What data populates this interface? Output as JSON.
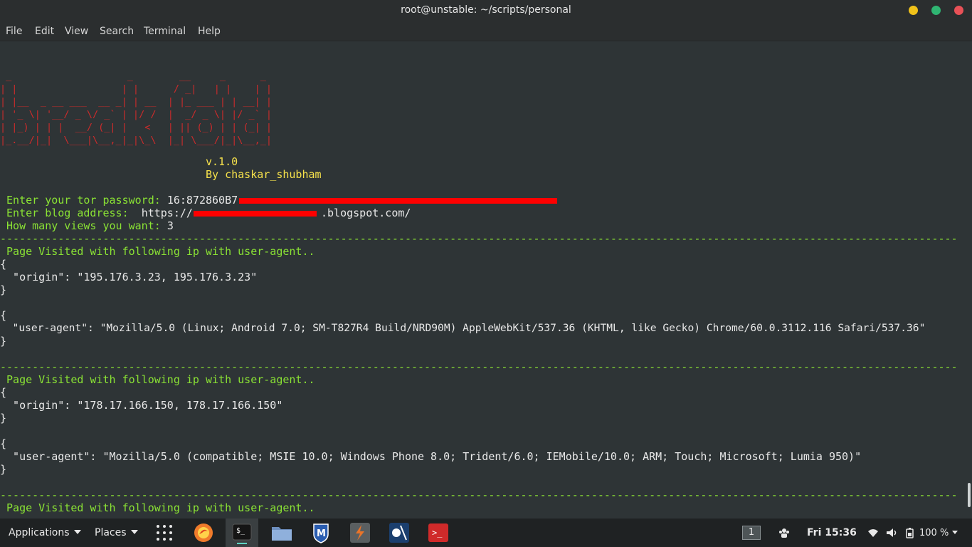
{
  "window": {
    "title": "root@unstable: ~/scripts/personal",
    "controls": {
      "minimize_color": "#f0c21a",
      "maximize_color": "#2fb572",
      "close_color": "#e85157"
    }
  },
  "menubar": {
    "items": [
      "File",
      "Edit",
      "View",
      "Search",
      "Terminal",
      "Help"
    ]
  },
  "terminal": {
    "banner_ascii": [
      " _                    _        __     _      _ ",
      "| |                  | |      / _|   | |    | |",
      "| |__  _ __ ___  __ _| | __  | |_ ___ | | __| |",
      "| '_ \\| '__/ _ \\/ _` | |/ /  |  _/ _ \\| |/ _` |",
      "| |_) | | |  __/ (_| |   <   | || (_) | | (_| |",
      "|_.__/|_|  \\___|\\__,_|_|\\_\\  |_| \\___/|_|\\__,_|"
    ],
    "version": "v.1.0",
    "author": "By chaskar_shubham",
    "prompts": {
      "tor_label": " Enter your tor password: ",
      "tor_value": "16:872860B7",
      "blog_label": " Enter blog address:  ",
      "blog_prefix": "https://",
      "blog_suffix": ".blogspot.com/",
      "views_label": " How many views you want: ",
      "views_value": "3"
    },
    "separator": "-----------------------------------------------------------------------------------------------------------------------------------------------------",
    "visits": [
      {
        "header": " Page Visited with following ip with user-agent..",
        "open1": "{",
        "origin_line": "  \"origin\": \"195.176.3.23, 195.176.3.23\"",
        "close1": "}",
        "open2": "{",
        "ua_line": "  \"user-agent\": \"Mozilla/5.0 (Linux; Android 7.0; SM-T827R4 Build/NRD90M) AppleWebKit/537.36 (KHTML, like Gecko) Chrome/60.0.3112.116 Safari/537.36\"",
        "close2": "}"
      },
      {
        "header": " Page Visited with following ip with user-agent..",
        "open1": "{",
        "origin_line": "  \"origin\": \"178.17.166.150, 178.17.166.150\"",
        "close1": "}",
        "open2": "{",
        "ua_line": "  \"user-agent\": \"Mozilla/5.0 (compatible; MSIE 10.0; Windows Phone 8.0; Trident/6.0; IEMobile/10.0; ARM; Touch; Microsoft; Lumia 950)\"",
        "close2": "}"
      },
      {
        "header": " Page Visited with following ip with user-agent.."
      }
    ],
    "colors": {
      "background": "#2e3436",
      "banner": "#cc2b2b",
      "version": "#f7e24b",
      "prompt": "#8ae234",
      "redaction": "#ff0000"
    }
  },
  "taskbar": {
    "applications_label": "Applications",
    "places_label": "Places",
    "launchers": [
      {
        "icon": "firefox-icon",
        "color": "#f07b2b"
      },
      {
        "icon": "terminal-icon",
        "color": "#2a2a2a"
      },
      {
        "icon": "files-icon",
        "color": "#6d8fbf"
      },
      {
        "icon": "metasploit-icon",
        "color": "#2a5db0"
      },
      {
        "icon": "burpsuite-icon",
        "color": "#e8742a"
      },
      {
        "icon": "cherrytree-icon",
        "color": "#3b6fb0"
      },
      {
        "icon": "redterm-icon",
        "color": "#d02a2a"
      }
    ],
    "workspace": "1",
    "clock": "Fri 15:36",
    "battery": "100 %"
  }
}
